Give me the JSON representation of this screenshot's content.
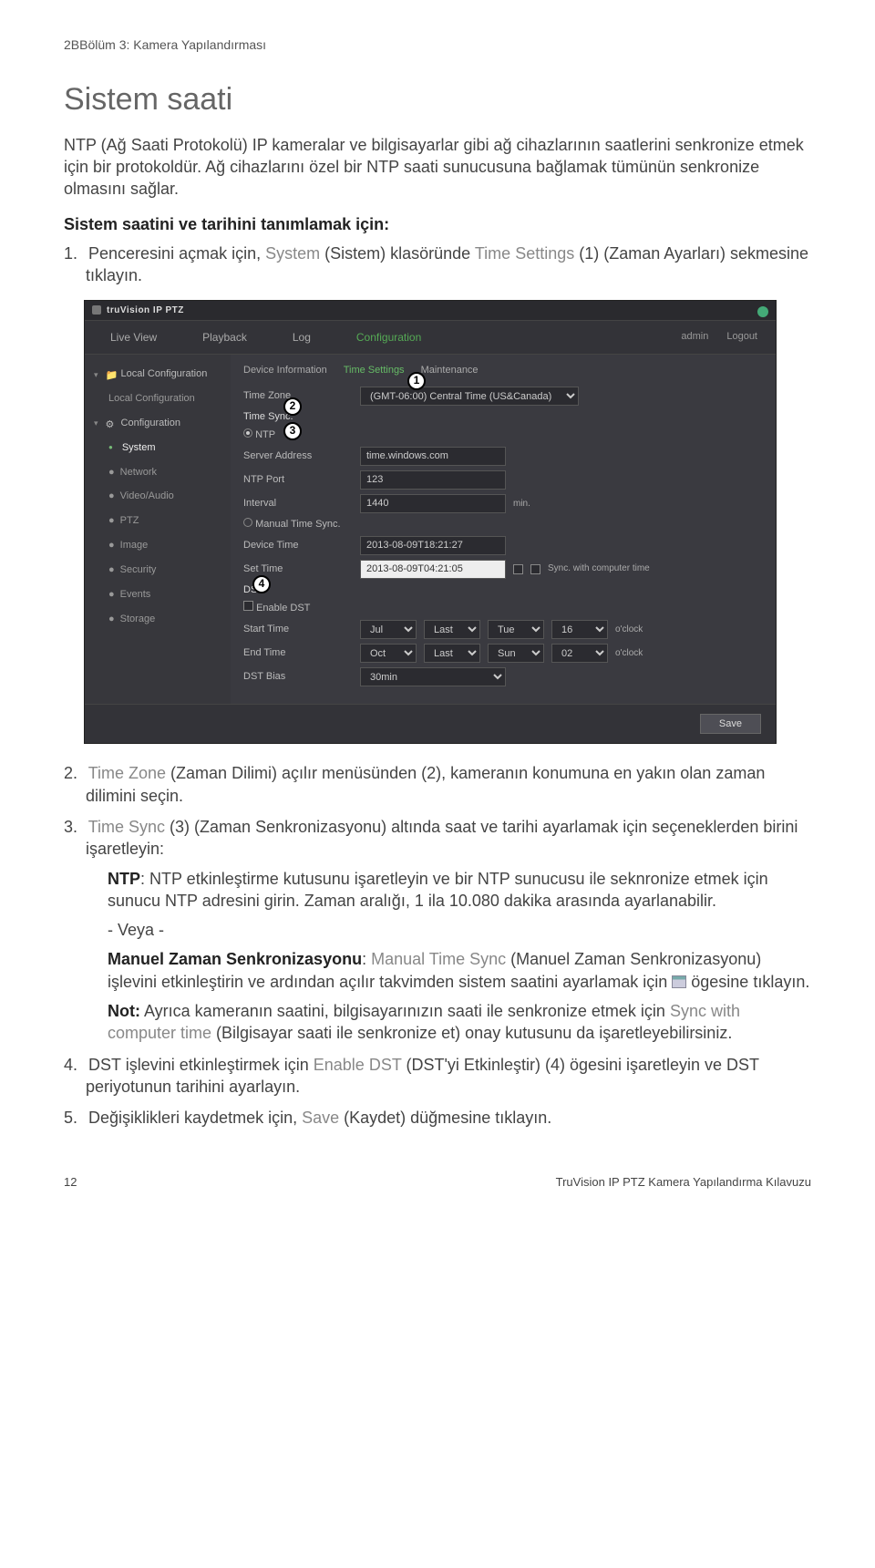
{
  "header": "2BBölüm 3: Kamera Yapılandırması",
  "title": "Sistem saati",
  "intro1": "NTP (Ağ Saati Protokolü) IP kameralar ve bilgisayarlar gibi ağ cihazlarının saatlerini senkronize etmek için bir protokoldür. Ağ cihazlarını özel bir NTP saati sunucusuna bağlamak tümünün senkronize olmasını sağlar.",
  "subtitle": "Sistem saatini ve tarihini tanımlamak için:",
  "step1_a": "1.",
  "step1_b": "Penceresini açmak için, ",
  "step1_c": "System",
  "step1_d": " (Sistem) klasöründe ",
  "step1_e": "Time Settings",
  "step1_f": " (1) (Zaman Ayarları) sekmesine tıklayın.",
  "step2_a": "2.",
  "step2_b": "Time Zone",
  "step2_c": " (Zaman Dilimi) açılır menüsünden (2), kameranın konumuna en yakın olan zaman dilimini seçin.",
  "step3_a": "3.",
  "step3_b": "Time Sync",
  "step3_c": " (3) (Zaman Senkronizasyonu) altında saat ve tarihi ayarlamak için seçeneklerden birini işaretleyin:",
  "ntp_a": "NTP",
  "ntp_b": ": NTP etkinleştirme kutusunu işaretleyin ve bir NTP sunucusu ile seknronize etmek için sunucu NTP adresini girin. Zaman aralığı, 1 ila 10.080 dakika arasında ayarlanabilir.",
  "or": "- Veya -",
  "mts_a": "Manuel Zaman Senkronizasyonu",
  "mts_b": ": ",
  "mts_c": "Manual Time Sync",
  "mts_d": " (Manuel Zaman Senkronizasyonu) işlevini etkinleştirin ve ardından açılır takvimden sistem saatini ayarlamak için ",
  "mts_e": " ögesine tıklayın.",
  "note_a": "Not:",
  "note_b": " Ayrıca kameranın saatini, bilgisayarınızın saati ile senkronize etmek için ",
  "note_c": "Sync with computer time",
  "note_d": " (Bilgisayar saati ile senkronize et) onay kutusunu da işaretleyebilirsiniz.",
  "step4_a": "4.",
  "step4_b": "DST işlevini etkinleştirmek için ",
  "step4_c": "Enable DST",
  "step4_d": " (DST'yi Etkinleştir) (4) ögesini işaretleyin ve DST periyotunun tarihini ayarlayın.",
  "step5_a": "5.",
  "step5_b": "Değişiklikleri kaydetmek için, ",
  "step5_c": "Save",
  "step5_d": " (Kaydet) düğmesine tıklayın.",
  "footer_page": "12",
  "footer_title": "TruVision IP PTZ Kamera Yapılandırma Kılavuzu",
  "ui": {
    "brand": "truVision IP PTZ",
    "menu": {
      "live": "Live View",
      "playback": "Playback",
      "log": "Log",
      "config": "Configuration",
      "admin": "admin",
      "logout": "Logout"
    },
    "sidebar": {
      "local": "Local Configuration",
      "localsub": "Local Configuration",
      "config": "Configuration",
      "system": "System",
      "network": "Network",
      "video": "Video/Audio",
      "ptz": "PTZ",
      "image": "Image",
      "security": "Security",
      "events": "Events",
      "storage": "Storage"
    },
    "tabs": {
      "devinfo": "Device Information",
      "time": "Time Settings",
      "maint": "Maintenance"
    },
    "labels": {
      "timezone": "Time Zone",
      "timesync": "Time Sync.",
      "ntp": "NTP",
      "serveraddr": "Server Address",
      "ntpport": "NTP Port",
      "interval": "Interval",
      "min": "min.",
      "manual": "Manual Time Sync.",
      "devicetime": "Device Time",
      "settime": "Set Time",
      "sync": "Sync. with computer time",
      "dst": "DST",
      "enabledst": "Enable DST",
      "start": "Start Time",
      "end": "End Time",
      "bias": "DST Bias",
      "oclock": "o'clock",
      "save": "Save"
    },
    "values": {
      "tz": "(GMT-06:00) Central Time (US&Canada)",
      "server": "time.windows.com",
      "port": "123",
      "interval": "1440",
      "devtime": "2013-08-09T18:21:27",
      "settime": "2013-08-09T04:21:05",
      "start": {
        "m": "Jul",
        "w": "Last",
        "d": "Tue",
        "h": "16"
      },
      "end": {
        "m": "Oct",
        "w": "Last",
        "d": "Sun",
        "h": "02"
      },
      "bias": "30min"
    }
  }
}
